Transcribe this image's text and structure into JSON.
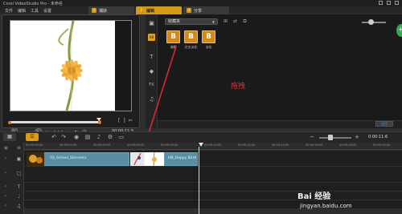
{
  "titlebar": {
    "title": "Corel VideoStudio Pro - 未命名"
  },
  "menu": {
    "items": [
      "文件",
      "编辑",
      "工具",
      "设置"
    ]
  },
  "steps": [
    {
      "num": "1",
      "label": "捕获"
    },
    {
      "num": "2",
      "label": "编辑"
    },
    {
      "num": "3",
      "label": "分享"
    }
  ],
  "preview": {
    "mode_label": "项目",
    "mode_sub": "素材",
    "timecode": "00:00:11:5",
    "transport": [
      "⏮",
      "◀",
      "▶▶",
      "▶",
      "⏭",
      "↻",
      "🔊"
    ],
    "mark_buttons": [
      "[",
      "]",
      "✂"
    ]
  },
  "library": {
    "dropdown_value": "收藏夹",
    "thumbs": [
      {
        "glyph": "B",
        "label": "溶解"
      },
      {
        "glyph": "B",
        "label": "交叉淡化"
      },
      {
        "glyph": "B",
        "label": "淡化"
      }
    ],
    "footer_button": "选项",
    "side_icons": [
      "media-icon",
      "transition-icon",
      "title-icon",
      "graphic-icon",
      "filter-icon",
      "audio-icon"
    ],
    "side_glyphs": [
      "▣",
      "AB",
      "T",
      "◆",
      "FX",
      "♫"
    ]
  },
  "annotation": {
    "drag_label": "拖拽"
  },
  "timeline": {
    "timecode": "0:00:11:6",
    "ruler_ticks": [
      "00:00:00:00",
      "00:00:02:00",
      "00:00:04:00",
      "00:00:06:00",
      "00:00:08:00",
      "00:00:10:00",
      "00:00:12:00",
      "00:00:14:00",
      "00:00:16:00",
      "00:00:18:00",
      "00:00:20:00"
    ],
    "clip1_label": "03_School_Starsemi",
    "clip2_label": "HB_Happy Birth"
  },
  "watermark": {
    "main": "Bai 经验",
    "sub": "jingyan.baidu.com"
  },
  "colors": {
    "accent": "#d99b18",
    "clip": "#5a8fa3",
    "annotation": "#e03030",
    "arrow": "#d42a2a"
  }
}
